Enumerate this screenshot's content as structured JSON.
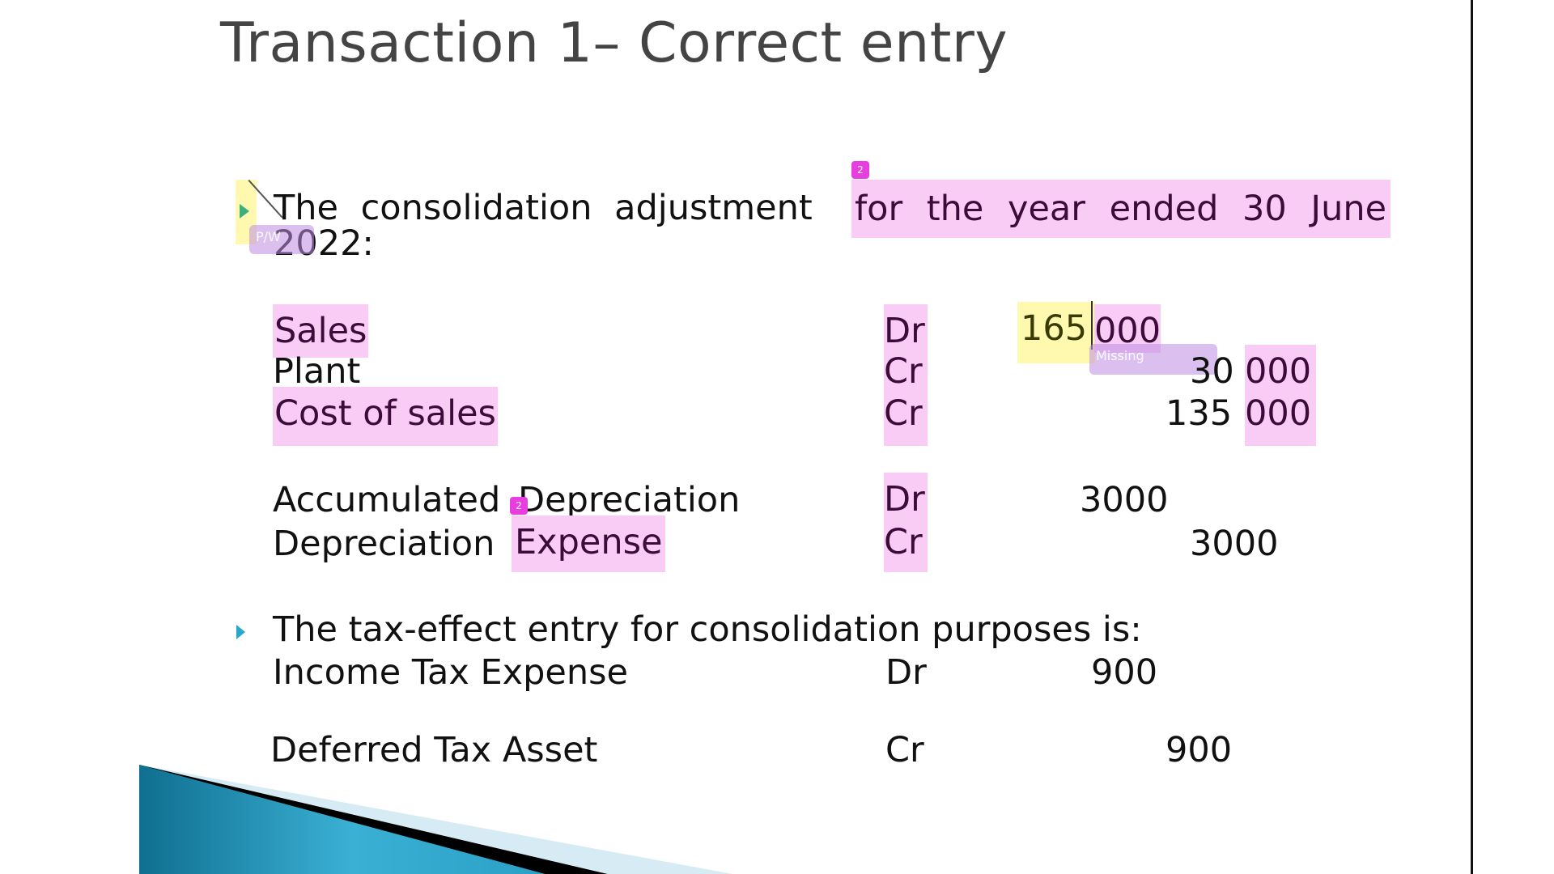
{
  "slide": {
    "title": "Transaction 1– Correct entry",
    "intro": {
      "part1": "The consolidation adjustment",
      "part2_highlighted": "for the year ended 30 June",
      "line2": "2022:"
    },
    "journal1": [
      {
        "account": "Sales",
        "side": "Dr",
        "debit_prefix": "165",
        "debit_suffix": "000"
      },
      {
        "account": "Plant",
        "side": "Cr",
        "credit_prefix": "30",
        "credit_suffix": "000"
      },
      {
        "account": "Cost of sales",
        "side": "Cr",
        "credit_prefix": "135",
        "credit_suffix": "000"
      }
    ],
    "journal2": [
      {
        "account_a": "Accumulated",
        "account_b": "Depreciation",
        "side": "Dr",
        "debit": "3000"
      },
      {
        "account_a": "Depreciation",
        "account_b": "Expense",
        "side": "Cr",
        "credit": "3000"
      }
    ],
    "tax_intro": "The tax-effect entry for consolidation purposes is:",
    "journal3": [
      {
        "account": "Income Tax Expense",
        "side": "Dr",
        "debit": "900"
      },
      {
        "account": "Deferred Tax Asset",
        "side": "Cr",
        "credit": "900"
      }
    ]
  },
  "annotations": {
    "tag_label": "2",
    "missing_label": "Missing",
    "pw_label": "P/W"
  },
  "colors": {
    "highlight_pink": "#f9ccf5",
    "highlight_yellow": "#fff9b0",
    "annotation_purple": "#be8ce1",
    "tag_magenta": "#e83ee0",
    "bullet_green": "#3bb07a",
    "bullet_blue": "#2aa8cc",
    "title_gray": "#444444"
  }
}
